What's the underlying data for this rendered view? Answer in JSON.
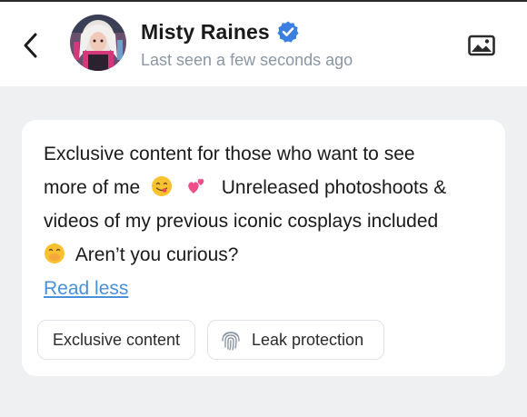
{
  "header": {
    "name": "Misty Raines",
    "last_seen": "Last seen a few seconds ago",
    "icons": {
      "back": "chevron-left-icon",
      "verified": "verified-badge-icon",
      "media": "image-icon"
    },
    "verified_color": "#3b7fe0"
  },
  "about": {
    "line_1": "Exclusive content for those who want to see",
    "line_2_prefix": "more of me",
    "line_2_suffix": "Unreleased photoshoots &",
    "line_3": "videos of my previous iconic cosplays included",
    "line_4_suffix": "Aren’t you curious?",
    "emojis": [
      "face-savoring-food-emoji",
      "two-hearts-emoji",
      "face-with-hand-over-mouth-emoji"
    ],
    "read_less": "Read less",
    "link_color": "#4a90d9"
  },
  "tags": {
    "exclusive": "Exclusive content",
    "leak": "Leak protection",
    "leak_icon": "fingerprint-icon"
  }
}
